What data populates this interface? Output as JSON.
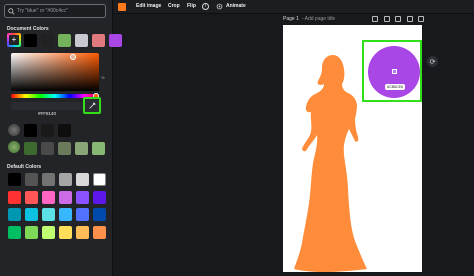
{
  "search": {
    "placeholder": "Try \"blue\" or \"#00c4cc\""
  },
  "document_colors": {
    "title": "Document Colors",
    "swatches": [
      "#000000",
      "#212121",
      "#74b25b",
      "#c8c8d0",
      "#e07a7f",
      "#a846e6"
    ]
  },
  "picker": {
    "hex": "#FF8140",
    "hue_label": "%",
    "eyedropper_icon": "eyedropper-icon"
  },
  "photo_colors": {
    "row1": [
      "#000000",
      "#1a1a1a",
      "#0e0e0e"
    ],
    "row2": [
      "#3d6b2f",
      "#4a4a4a",
      "#6a7a5a",
      "#8aa678",
      "#86b873"
    ]
  },
  "default_colors": {
    "title": "Default Colors",
    "rows": [
      [
        "#000000",
        "#545454",
        "#737373",
        "#a6a6a6",
        "#d9d9d9",
        "#ffffff"
      ],
      [
        "#ff3131",
        "#ff5757",
        "#ff66c4",
        "#cb6ce6",
        "#8c52ff",
        "#5e17eb"
      ],
      [
        "#0097b2",
        "#0cc0df",
        "#5ce1e6",
        "#38b6ff",
        "#5271ff",
        "#004aad"
      ],
      [
        "#00bf63",
        "#7ed957",
        "#c1ff72",
        "#ffde59",
        "#ffbd59",
        "#ff914d"
      ]
    ]
  },
  "toolbar": {
    "swatch_color": "#ff7a1a",
    "edit_image": "Edit image",
    "crop": "Crop",
    "flip": "Flip",
    "info": "i",
    "animate": "Animate"
  },
  "page": {
    "title": "Page 1",
    "subtitle": "- Add page title"
  },
  "selection": {
    "label": "#CB6CE6",
    "color": "#a846e6"
  },
  "figure_color": "#ff8c3a",
  "accent_highlight": "#32e01a"
}
